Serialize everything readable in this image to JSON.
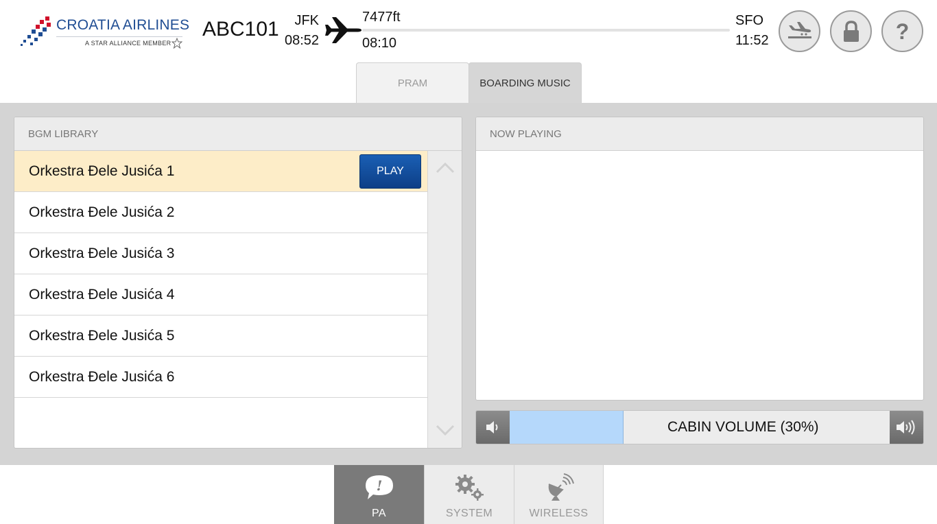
{
  "brand": {
    "name": "CROATIA AIRLINES",
    "tagline": "A STAR ALLIANCE MEMBER",
    "colors": {
      "blue": "#1f4d93",
      "red": "#d0112b"
    }
  },
  "flight": {
    "number": "ABC101",
    "origin": {
      "code": "JFK",
      "time": "08:52"
    },
    "destination": {
      "code": "SFO",
      "time": "11:52"
    },
    "altitude": "7477ft",
    "elapsed": "08:10",
    "progress_fraction": 0.0
  },
  "header_buttons": [
    {
      "icon": "landing-plane-icon"
    },
    {
      "icon": "lock-icon"
    },
    {
      "icon": "help-icon",
      "glyph": "?"
    }
  ],
  "tabs": [
    {
      "label": "PRAM",
      "active": false
    },
    {
      "label": "BOARDING MUSIC",
      "active": true
    }
  ],
  "library": {
    "title": "BGM LIBRARY",
    "play_label": "PLAY",
    "selected_index": 0,
    "tracks": [
      "Orkestra Đele Jusića 1",
      "Orkestra Đele Jusića 2",
      "Orkestra Đele Jusića 3",
      "Orkestra Đele Jusića 4",
      "Orkestra Đele Jusića 5",
      "Orkestra Đele Jusića 6"
    ]
  },
  "now_playing": {
    "title": "NOW PLAYING"
  },
  "volume": {
    "label": "CABIN VOLUME (30%)",
    "level_fraction": 0.3,
    "fill_color": "#b5d8fb"
  },
  "bottom_nav": [
    {
      "label": "PA",
      "icon": "speech-bubble-exclamation-icon",
      "active": true
    },
    {
      "label": "SYSTEM",
      "icon": "gears-icon",
      "active": false
    },
    {
      "label": "WIRELESS",
      "icon": "satellite-dish-icon",
      "active": false
    }
  ]
}
